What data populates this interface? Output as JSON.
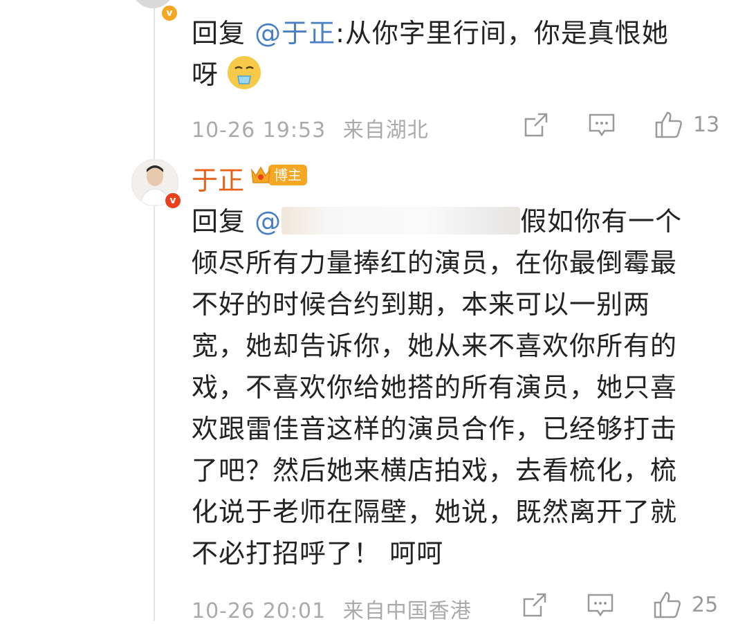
{
  "comment1": {
    "reply_prefix": "回复",
    "mention": "@于正",
    "text": ":从你字里行间，你是真恨她",
    "text_line2": "呀",
    "emoji": "face-with-steam-emoji",
    "timestamp": "10-26 19:53",
    "location": "来自湖北",
    "like_count": "13"
  },
  "comment2": {
    "username": "于正",
    "badge_label": "博主",
    "reply_prefix": "回复",
    "mention": "@",
    "text_lines": [
      "假如你有一个",
      "倾尽所有力量捧红的演员，在你最倒霉最",
      "不好的时候合约到期，本来可以一别两",
      "宽，她却告诉你，她从来不喜欢你所有的",
      "戏，不喜欢你给她搭的所有演员，她只喜",
      "欢跟雷佳音这样的演员合作，已经够打击",
      "了吧？然后她来横店拍戏，去看梳化，梳",
      "化说于老师在隔壁，她说，既然离开了就",
      "不必打招呼了！ 呵呵"
    ],
    "timestamp": "10-26 20:01",
    "location": "来自中国香港",
    "like_count": "25"
  },
  "icons": {
    "share": "share-icon",
    "comment": "comment-icon",
    "like": "thumbs-up-icon",
    "verified": "verified-badge-icon"
  },
  "colors": {
    "mention": "#4a7fc1",
    "username": "#e8611b",
    "meta": "#aaaaaa",
    "badge": "#f5a623"
  }
}
